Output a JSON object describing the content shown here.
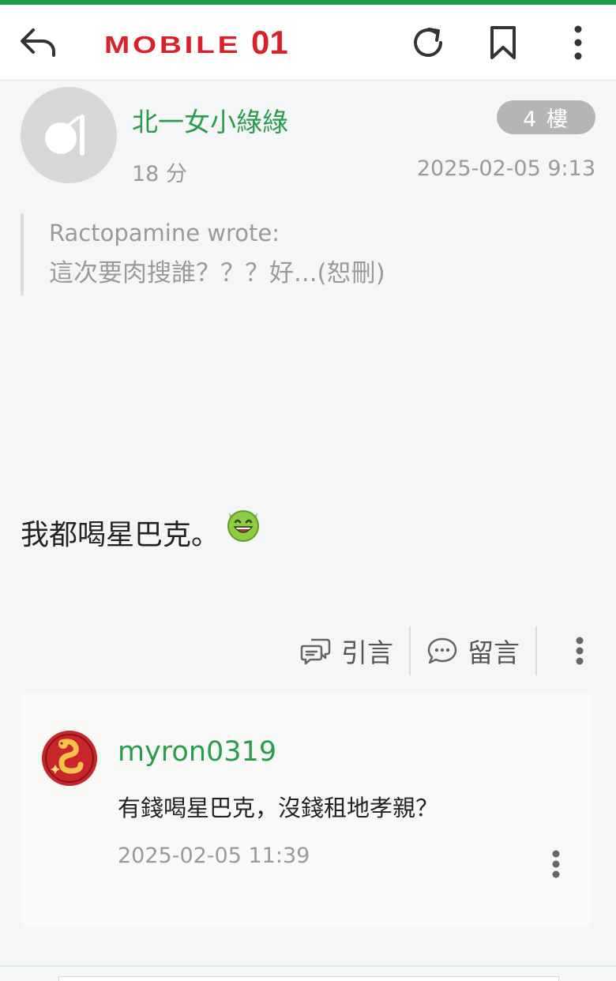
{
  "header": {
    "logo_text": "MOBILE",
    "logo_num": "01",
    "icons": [
      "back-icon",
      "refresh-icon",
      "bookmark-icon",
      "more-vertical-icon"
    ]
  },
  "post": {
    "username": "北一女小綠綠",
    "floor_label": "4 樓",
    "relative_time": "18 分",
    "timestamp": "2025-02-05 9:13",
    "quote": {
      "author_line": "Ractopamine wrote:",
      "text": "這次要肉搜誰？？？好...(恕刪)"
    },
    "body": "我都喝星巴克。",
    "actions": {
      "quote_label": "引言",
      "comment_label": "留言"
    }
  },
  "comment": {
    "username": "myron0319",
    "text": "有錢喝星巴克，沒錢租地孝親？",
    "timestamp": "2025-02-05 11:39"
  },
  "colors": {
    "brand_green": "#1a9b4a",
    "username_green": "#2a9d4c",
    "logo_red": "#d8222a",
    "badge_gray": "#b5b5b5"
  }
}
